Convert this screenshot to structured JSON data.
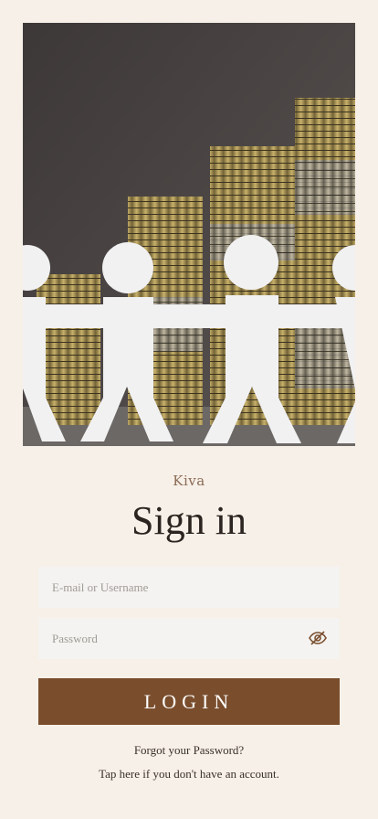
{
  "app": {
    "brand": "Kiva",
    "title": "Sign in"
  },
  "form": {
    "email_placeholder": "E-mail or Username",
    "email_value": "",
    "password_placeholder": "Password",
    "password_value": "",
    "login_label": "LOGIN",
    "forgot_label": "Forgot your Password?",
    "signup_label": "Tap here if you don't have an account."
  },
  "icons": {
    "password_toggle": "eye-slash-icon"
  },
  "colors": {
    "background": "#f7f0e8",
    "accent": "#7a4e2d",
    "brand_text": "#8b6a55",
    "field_bg": "#f4f3f1"
  }
}
